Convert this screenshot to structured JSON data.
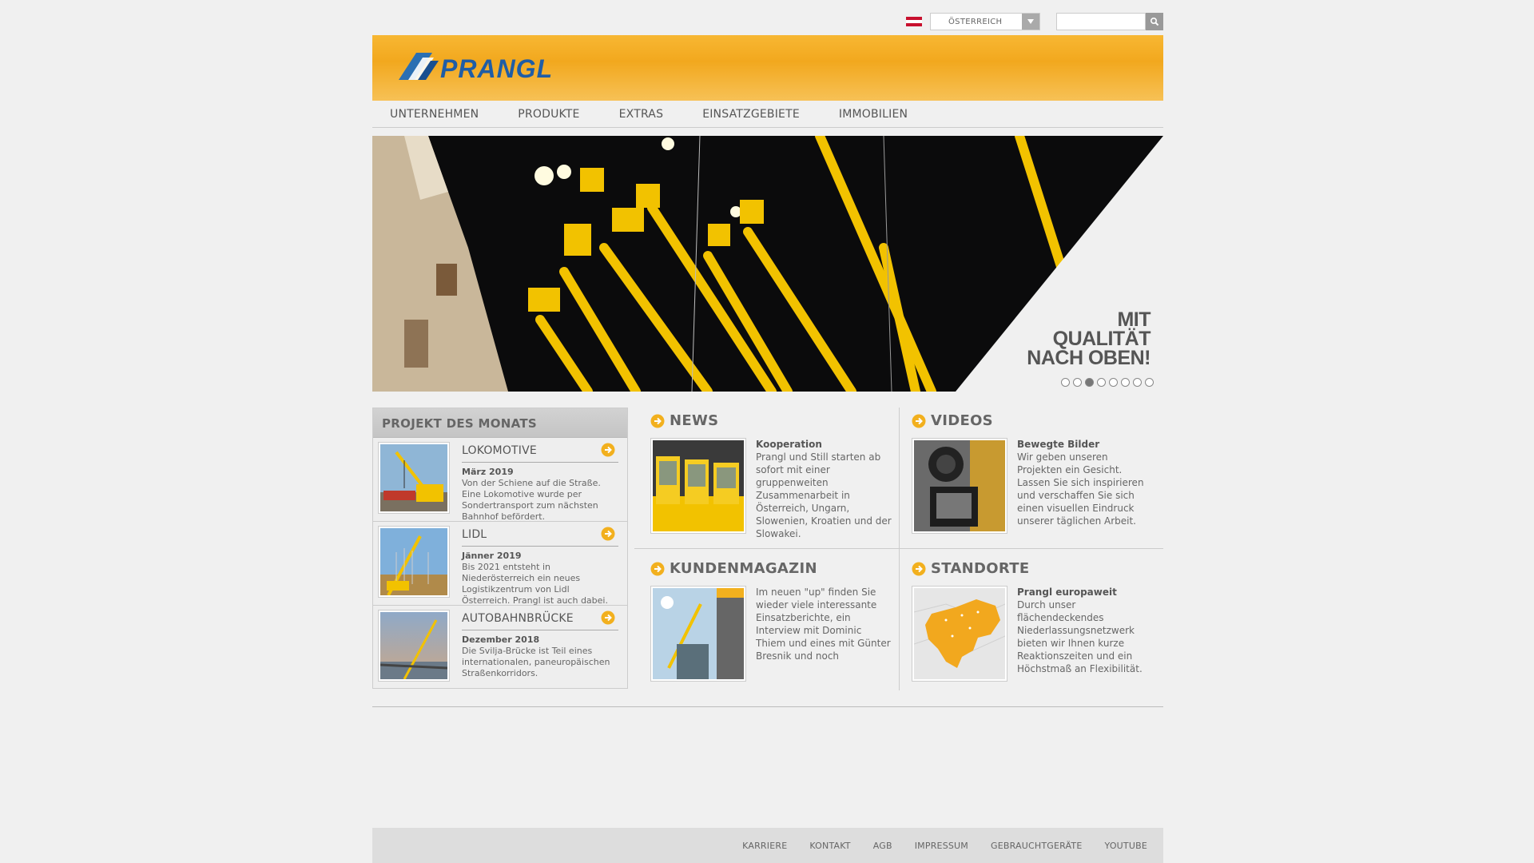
{
  "topbar": {
    "country": "ÖSTERREICH",
    "search_placeholder": "",
    "flag_colors": [
      "#c8102e",
      "#ffffff",
      "#c8102e"
    ]
  },
  "header": {
    "logo_text": "PRANGL",
    "brand_color": "#f2a81e"
  },
  "nav": {
    "items": [
      "UNTERNEHMEN",
      "PRODUKTE",
      "EXTRAS",
      "EINSATZGEBIETE",
      "IMMOBILIEN"
    ]
  },
  "banner": {
    "slogan_line1": "MIT",
    "slogan_line2": "QUALITÄT",
    "slogan_line3": "NACH OBEN!",
    "slide_count": 8,
    "active_slide": 3
  },
  "projekt": {
    "heading": "PROJEKT DES MONATS",
    "items": [
      {
        "title": "LOKOMOTIVE",
        "date": "März 2019",
        "text": "Von der Schiene auf die Straße. Eine Lokomotive wurde per Sondertransport zum nächsten Bahnhof befördert."
      },
      {
        "title": "LIDL",
        "date": "Jänner 2019",
        "text": "Bis 2021 entsteht in Niederösterreich ein neues Logistikzentrum von Lidl Österreich. Prangl ist auch dabei."
      },
      {
        "title": "AUTOBAHNBRÜCKE",
        "date": "Dezember 2018",
        "text": "Die Svilja-Brücke ist Teil eines internationalen, paneuropäischen Straßenkorridors."
      }
    ]
  },
  "news": {
    "heading": "NEWS",
    "title": "Kooperation",
    "text": "Prangl und Still starten ab sofort mit einer gruppenweiten Zusammenarbeit in Österreich, Ungarn, Slowenien, Kroatien und der Slowakei."
  },
  "videos": {
    "heading": "VIDEOS",
    "title": "Bewegte Bilder",
    "text": "Wir geben unseren Projekten ein Gesicht. Lassen Sie sich inspirieren und verschaffen Sie sich einen visuellen Eindruck unserer täglichen Arbeit."
  },
  "kundenmagazin": {
    "heading": "KUNDENMAGAZIN",
    "text": "Im neuen \"up\" finden Sie wieder viele interessante Einsatzberichte, ein Interview mit Dominic Thiem und eines mit Günter Bresnik und noch"
  },
  "standorte": {
    "heading": "STANDORTE",
    "title": "Prangl europaweit",
    "text": "Durch unser flächendeckendes Niederlassungsnetzwerk bieten wir Ihnen kurze Reaktionszeiten und ein Höchstmaß an Flexibilität."
  },
  "footer": {
    "links": [
      "KARRIERE",
      "KONTAKT",
      "AGB",
      "IMPRESSUM",
      "GEBRAUCHTGERÄTE",
      "YOUTUBE"
    ]
  }
}
